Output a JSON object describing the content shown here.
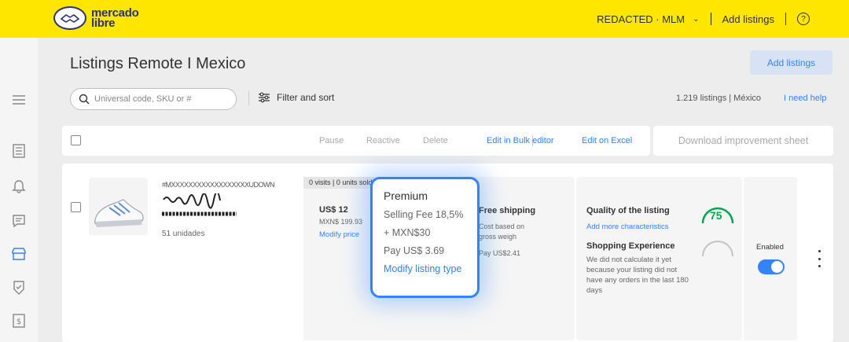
{
  "topbar": {
    "logo_text": "mercado\nlibre",
    "user_label": "REDACTED · MLM",
    "add_listings": "Add listings",
    "help_glyph": "?"
  },
  "header": {
    "title": "Listings Remote I Mexico",
    "add_button": "Add listings"
  },
  "toolbar": {
    "search_placeholder": "Universal code, SKU or #",
    "filter_label": "Filter and sort",
    "count_label": "1.219 listings | México",
    "help_link": "I need help"
  },
  "bulk_actions": {
    "pause": "Pause",
    "reactive": "Reactive",
    "delete": "Delete",
    "bulk_editor": "Edit in Bulk editor",
    "excel": "Edit on Excel",
    "download": "Download improvement sheet"
  },
  "listing": {
    "title_obscured": "#MXXXXXXXXXXXXXXXXXXUDOWN",
    "units": "51 unidades",
    "visits": "0 visits | 0 units sold",
    "price": "US$ 12",
    "price_mxn": "MXN$ 199.93",
    "modify_price": "Modify price",
    "shipping_title": "Free shipping",
    "shipping_cost": "Cost based on gross weigh",
    "shipping_pay": "Pay US$2.41",
    "quality_title": "Quality of the listing",
    "quality_score": "75",
    "quality_link": "Add more characteristics",
    "experience_title": "Shopping Experience",
    "experience_text": "We did not calculate it yet because your listing did not have any orders in the last 180 days",
    "status_label": "Enabled",
    "enabled": true
  },
  "popup": {
    "title": "Premium",
    "fee": "Selling Fee 18,5%",
    "fixed": "+ MXN$30",
    "pay": "Pay US$ 3.69",
    "link": "Modify listing type"
  },
  "colors": {
    "brand_yellow": "#ffe600",
    "accent_blue": "#3483fa",
    "brand_navy": "#2d3277",
    "quality_green": "#00a650"
  },
  "icons": {
    "sidebar": [
      "menu-icon",
      "list-icon",
      "bell-icon",
      "chat-icon",
      "store-icon",
      "badge-icon",
      "receipt-icon"
    ]
  }
}
